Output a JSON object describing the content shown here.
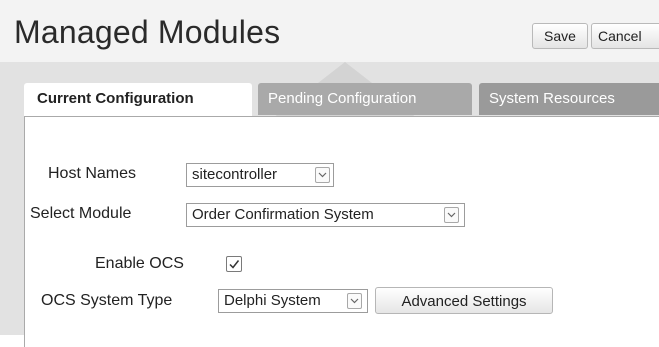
{
  "header": {
    "title": "Managed Modules",
    "save_label": "Save",
    "cancel_label": "Cancel"
  },
  "tabs": [
    {
      "label": "Current Configuration",
      "active": true
    },
    {
      "label": "Pending Configuration",
      "active": false
    },
    {
      "label": "System Resources",
      "active": false
    }
  ],
  "form": {
    "host_names": {
      "label": "Host Names",
      "value": "sitecontroller"
    },
    "select_module": {
      "label": "Select Module",
      "value": "Order Confirmation System"
    },
    "enable_ocs": {
      "label": "Enable OCS",
      "checked": true
    },
    "ocs_system_type": {
      "label": "OCS System Type",
      "value": "Delphi System"
    },
    "advanced_settings_label": "Advanced Settings"
  },
  "colors": {
    "header_bg": "#f3f3f3",
    "tabbar_bg": "#e2e2e2",
    "inactive_tab": "#a9a9a9"
  }
}
